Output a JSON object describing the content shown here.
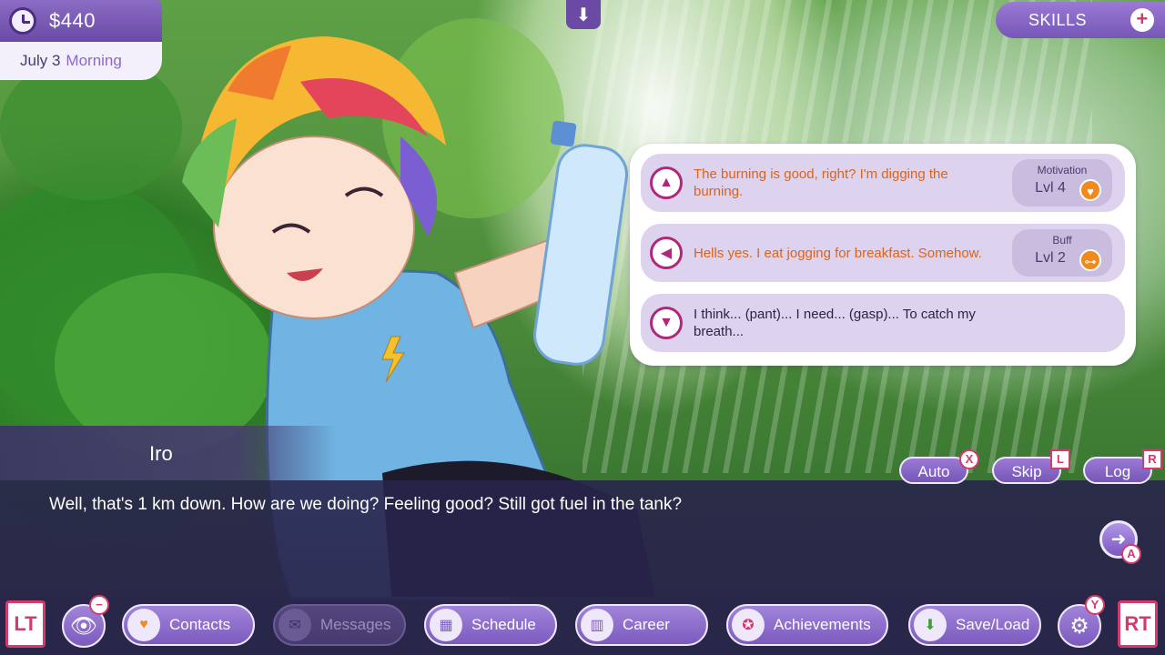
{
  "hud": {
    "money": "$440",
    "date": "July 3",
    "time_of_day": "Morning",
    "skills_label": "SKILLS"
  },
  "choices": [
    {
      "arrow": "up",
      "text": "The burning is good, right? I'm digging the burning.",
      "stat_name": "Motivation",
      "stat_level": "Lvl 4",
      "stat_icon": "heart-icon"
    },
    {
      "arrow": "left",
      "text": "Hells yes. I eat jogging for breakfast. Somehow.",
      "stat_name": "Buff",
      "stat_level": "Lvl 2",
      "stat_icon": "dumbbell-icon"
    },
    {
      "arrow": "down",
      "text": "I think... (pant)... I need... (gasp)... To catch my breath..."
    }
  ],
  "dialogue": {
    "speaker": "Iro",
    "line": "Well, that's 1 km down. How are we doing? Feeling good? Still got fuel in the tank?"
  },
  "controls": {
    "auto_label": "Auto",
    "auto_key": "X",
    "skip_label": "Skip",
    "skip_key": "L",
    "log_label": "Log",
    "log_key": "R",
    "next_key": "A"
  },
  "nav": {
    "lt": "LT",
    "rt": "RT",
    "view_key": "−",
    "settings_key": "Y",
    "items": [
      {
        "label": "Contacts",
        "icon": "heart-icon",
        "enabled": true
      },
      {
        "label": "Messages",
        "icon": "message-icon",
        "enabled": false
      },
      {
        "label": "Schedule",
        "icon": "calendar-icon",
        "enabled": true
      },
      {
        "label": "Career",
        "icon": "bar-chart-icon",
        "enabled": true
      },
      {
        "label": "Achievements",
        "icon": "medal-icon",
        "enabled": true
      },
      {
        "label": "Save/Load",
        "icon": "download-icon",
        "enabled": true
      }
    ]
  },
  "colors": {
    "accent_purple": "#7656b7",
    "key_pink": "#d43a6a",
    "choice_text_orange": "#d9641e"
  }
}
